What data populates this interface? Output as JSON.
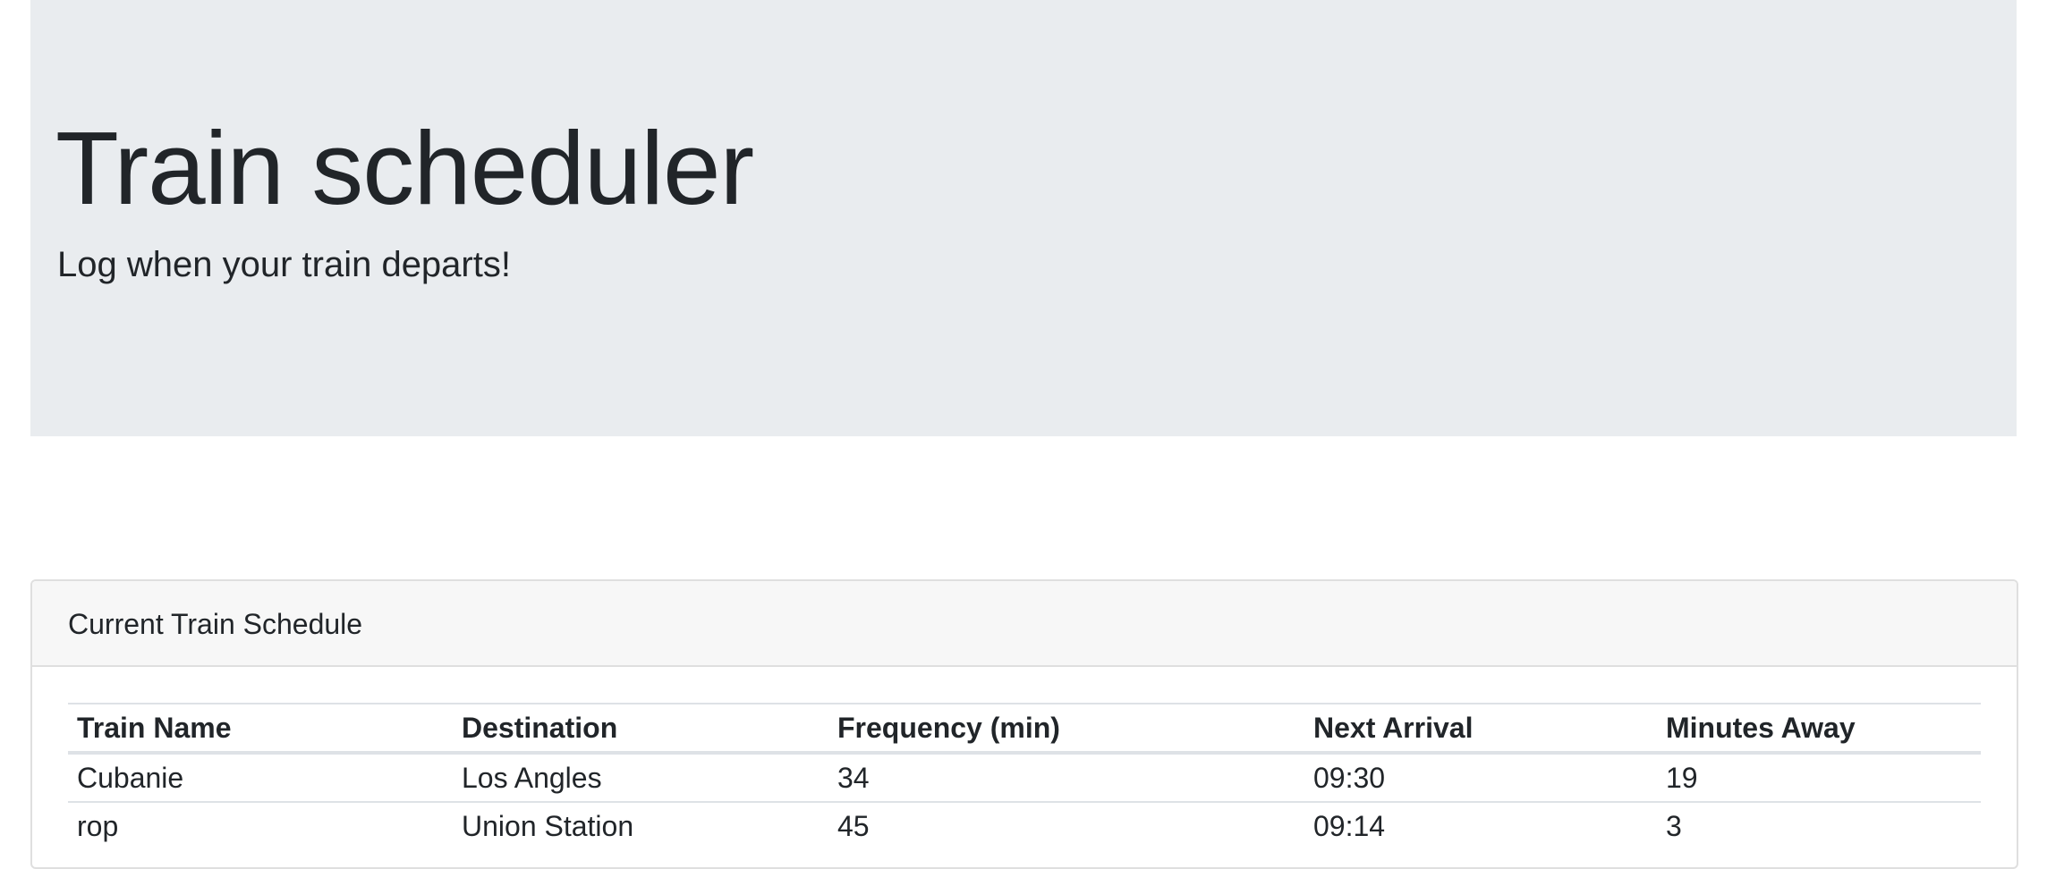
{
  "header": {
    "title": "Train scheduler",
    "subtitle": "Log when your train departs!"
  },
  "schedule": {
    "heading": "Current Train Schedule",
    "columns": [
      "Train Name",
      "Destination",
      "Frequency (min)",
      "Next Arrival",
      "Minutes Away"
    ],
    "rows": [
      [
        "Cubanie",
        "Los Angles",
        "34",
        "09:30",
        "19"
      ],
      [
        "rop",
        "Union Station",
        "45",
        "09:14",
        "3"
      ]
    ]
  },
  "colors": {
    "jumbotron_bg": "#e9ecef",
    "card_header_bg": "#f7f7f7",
    "text": "#212529"
  }
}
